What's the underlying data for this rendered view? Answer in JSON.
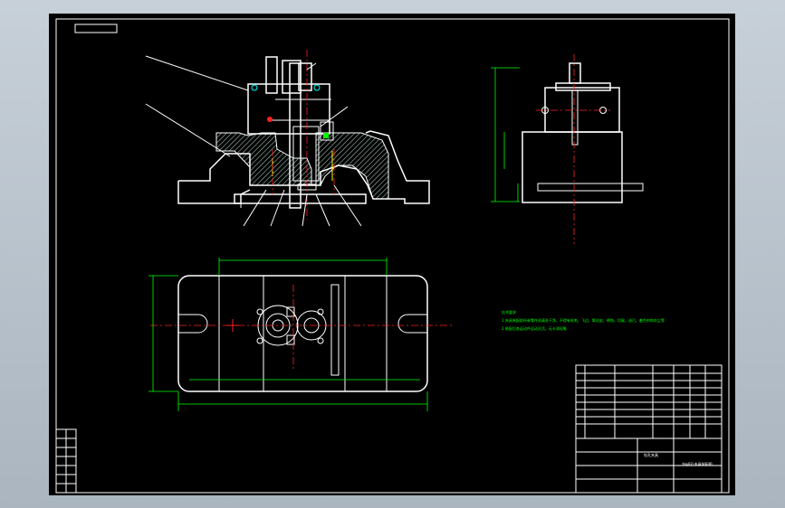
{
  "drawing": {
    "note_lines": [
      "技术要求",
      "1.夹具装配前所有零件须清洗干净，不得有毛刺，飞边，氧化皮，锈蚀，切屑，油污，着色剂和灰尘等",
      "2.装配后各运动件运动灵活，无卡滞现象"
    ],
    "title_block": {
      "part_name": "钻孔夹具",
      "drawing_name": "钻φ8孔夹具装配图"
    },
    "colors": {
      "background": "#000000",
      "outline": "#ffffff",
      "dimension": "#00ff00",
      "centerline": "#ff2020"
    }
  }
}
